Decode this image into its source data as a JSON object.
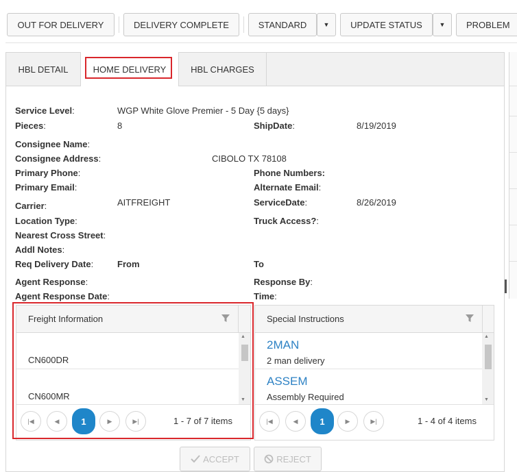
{
  "toolbar": {
    "out_for_delivery": "OUT FOR DELIVERY",
    "delivery_complete": "DELIVERY COMPLETE",
    "standard": "STANDARD",
    "update_status": "UPDATE STATUS",
    "problem": "PROBLEM"
  },
  "tabs": [
    {
      "label": "HBL DETAIL"
    },
    {
      "label": "HOME DELIVERY"
    },
    {
      "label": "HBL CHARGES"
    }
  ],
  "details": {
    "service_level_label": "Service Level",
    "service_level_value": "WGP White Glove Premier - 5 Day {5 days}",
    "pieces_label": "Pieces",
    "pieces_value": "8",
    "ship_date_label": "ShipDate",
    "ship_date_value": "8/19/2019",
    "consignee_name_label": "Consignee Name",
    "consignee_address_label": "Consignee Address",
    "consignee_address_value": "CIBOLO TX 78108",
    "primary_phone_label": "Primary Phone",
    "phone_numbers_label": "Phone Numbers:",
    "primary_email_label": "Primary Email",
    "alternate_email_label": "Alternate Email",
    "carrier_label": "Carrier",
    "carrier_value": "AITFREIGHT",
    "service_date_label": "ServiceDate",
    "service_date_value": "8/26/2019",
    "location_type_label": "Location Type",
    "truck_access_label": "Truck Access?",
    "nearest_cross_street_label": "Nearest Cross Street",
    "addl_notes_label": "Addl Notes",
    "req_delivery_date_label": "Req Delivery Date",
    "from_label": "From",
    "to_label": "To",
    "agent_response_label": "Agent Response",
    "response_by_label": "Response By",
    "agent_response_date_label": "Agent Response Date",
    "time_label": "Time"
  },
  "freight_grid": {
    "title": "Freight Information",
    "rows": [
      "CN600DR",
      "CN600MR"
    ],
    "current_page": "1",
    "page_info": "1 - 7 of 7 items"
  },
  "instructions_grid": {
    "title": "Special Instructions",
    "rows": [
      {
        "code": "2MAN",
        "description": "2 man delivery"
      },
      {
        "code": "ASSEM",
        "description": "Assembly Required"
      }
    ],
    "current_page": "1",
    "page_info": "1 - 4 of 4 items"
  },
  "actions": {
    "accept": "ACCEPT",
    "reject": "REJECT"
  },
  "colors": {
    "highlight": "#d9262b",
    "link": "#2e82c4",
    "pager_active": "#1f86c9"
  }
}
